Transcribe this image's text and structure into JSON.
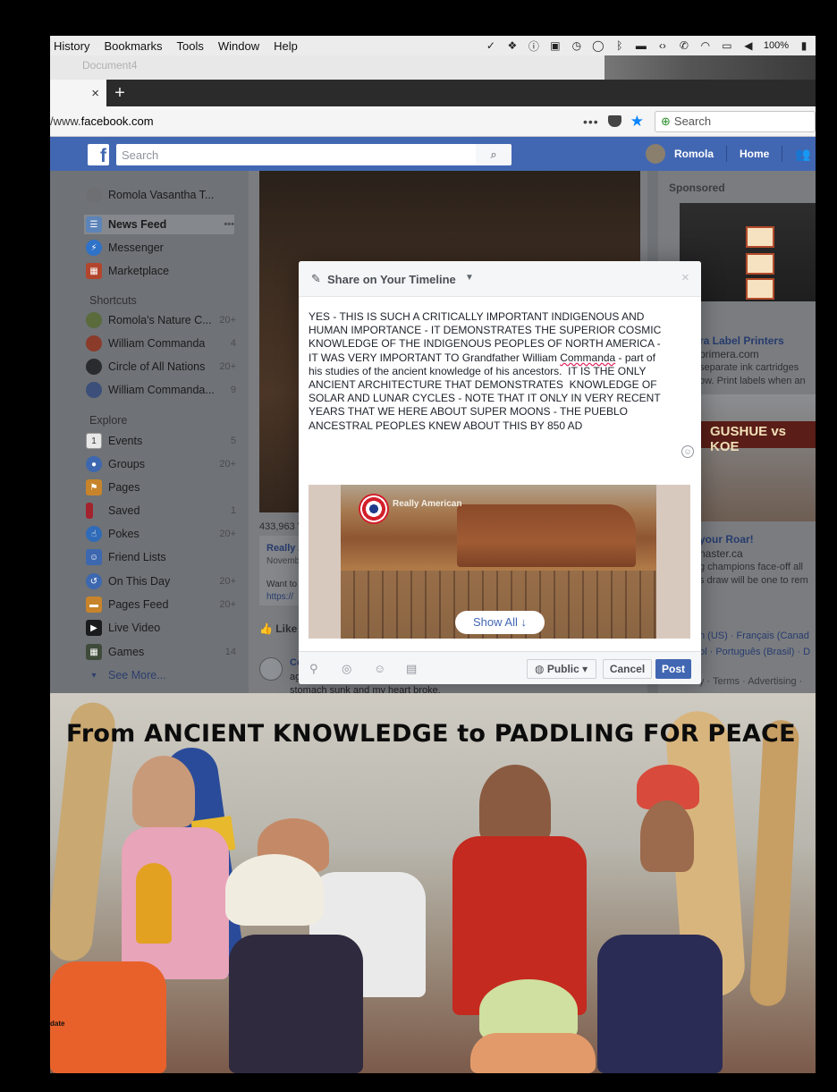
{
  "menubar": {
    "items": [
      "History",
      "Bookmarks",
      "Tools",
      "Window",
      "Help"
    ],
    "battery": "100%"
  },
  "window": {
    "document_title": "Document4"
  },
  "browser": {
    "url_prefix": "/www.",
    "url_domain": "facebook.com",
    "search_placeholder": "Search",
    "tab_close": "×",
    "new_tab": "+"
  },
  "fb_header": {
    "search_placeholder": "Search",
    "user": "Romola",
    "home": "Home"
  },
  "left_nav": {
    "profile": "Romola Vasantha T...",
    "main": [
      {
        "label": "News Feed",
        "count": "•••"
      },
      {
        "label": "Messenger",
        "count": ""
      },
      {
        "label": "Marketplace",
        "count": ""
      }
    ],
    "shortcuts_heading": "Shortcuts",
    "shortcuts": [
      {
        "label": "Romola's Nature C...",
        "count": "20+"
      },
      {
        "label": "William Commanda",
        "count": "4"
      },
      {
        "label": "Circle of All Nations",
        "count": "20+"
      },
      {
        "label": "William Commanda...",
        "count": "9"
      }
    ],
    "explore_heading": "Explore",
    "explore": [
      {
        "label": "Events",
        "count": "5"
      },
      {
        "label": "Groups",
        "count": "20+"
      },
      {
        "label": "Pages",
        "count": ""
      },
      {
        "label": "Saved",
        "count": "1"
      },
      {
        "label": "Pokes",
        "count": "20+"
      },
      {
        "label": "Friend Lists",
        "count": ""
      },
      {
        "label": "On This Day",
        "count": "20+"
      },
      {
        "label": "Pages Feed",
        "count": "20+"
      },
      {
        "label": "Live Video",
        "count": ""
      },
      {
        "label": "Games",
        "count": "14"
      }
    ],
    "see_more": "See More..."
  },
  "feed": {
    "views": "433,963 V",
    "link_title": "Really A",
    "link_date": "Novemb",
    "link_text": "Want to",
    "link_url": "https://",
    "like": "Like",
    "comment_name": "Co",
    "comment_line1": "ag",
    "comment_line2": "stomach sunk and my heart broke."
  },
  "right_col": {
    "sponsored": "Sponsored",
    "ad1_title": "ra Label Printers",
    "ad1_url": "primera.com",
    "ad1_text1": "separate ink cartridges",
    "ad1_text2": "ow. Print labels when an",
    "ad2_banner": "GUSHUE vs KOE",
    "ad2_title": "your Roar!",
    "ad2_url": "naster.ca",
    "ad2_text1": "g champions face-off all",
    "ad2_text2": "s draw will be one to rem",
    "lang1": "n (US) · Français (Canad",
    "lang2": "ol · Português (Brasil) · D",
    "terms": "y · Terms · Advertising ·"
  },
  "dialog": {
    "title": "Share on Your Timeline",
    "close": "×",
    "text_before": "YES - THIS IS SUCH A CRITICALLY IMPORTANT INDIGENOUS AND HUMAN IMPORTANCE - IT DEMONSTRATES THE SUPERIOR COSMIC KNOWLEDGE OF THE INDIGENOUS PEOPLES OF NORTH AMERICA - IT WAS VERY IMPORTANT TO Grandfather William ",
    "text_misspelled": "Commanda",
    "text_after": " - part of his studies of the ancient knowledge of his ancestors.  IT IS THE ONLY ANCIENT ARCHITECTURE THAT DEMONSTRATES  KNOWLEDGE OF SOLAR AND LUNAR CYCLES - NOTE THAT IT ONLY IN VERY RECENT YEARS THAT WE HERE ABOUT SUPER MOONS - THE PUEBLO ANCESTRAL PEOPLES KNEW ABOUT THIS BY 850 AD",
    "preview_brand": "Really American",
    "show_all": "Show All ↓",
    "privacy": "Public ▾",
    "cancel": "Cancel",
    "post": "Post"
  },
  "photo": {
    "title": "From ANCIENT KNOWLEDGE to PADDLING FOR PEACE",
    "date_label": "date"
  }
}
